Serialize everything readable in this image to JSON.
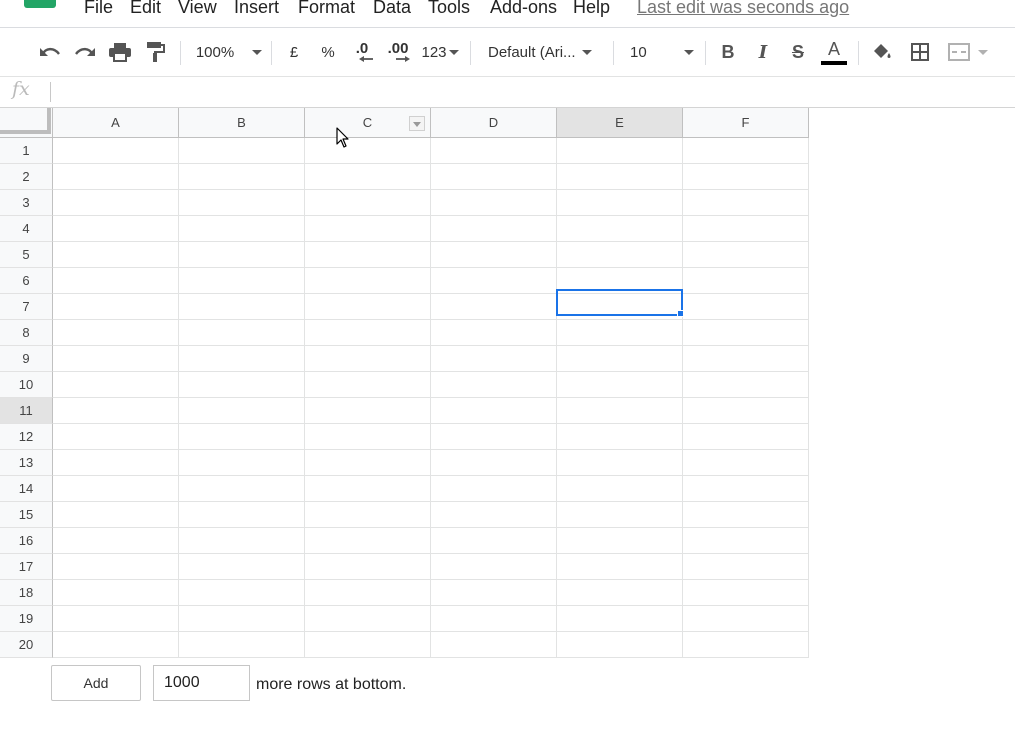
{
  "menu": {
    "items": [
      "File",
      "Edit",
      "View",
      "Insert",
      "Format",
      "Data",
      "Tools",
      "Add-ons",
      "Help"
    ],
    "last_edit": "Last edit was seconds ago"
  },
  "toolbar": {
    "zoom": "100%",
    "currency": "£",
    "percent": "%",
    "decrease_decimal": ".0",
    "increase_decimal": ".00",
    "more_formats": "123",
    "font_family": "Default (Ari...",
    "font_size": "10",
    "bold": "B",
    "italic": "I",
    "strikethrough": "S",
    "text_color_letter": "A",
    "text_color": "#000000",
    "icons": [
      "undo-icon",
      "redo-icon",
      "print-icon",
      "paint-format-icon",
      "fill-color-icon",
      "borders-icon",
      "merge-cells-icon"
    ]
  },
  "formula_bar": {
    "fx_label": "fx",
    "value": ""
  },
  "grid": {
    "columns": [
      "A",
      "B",
      "C",
      "D",
      "E",
      "F"
    ],
    "rows": [
      "1",
      "2",
      "3",
      "4",
      "5",
      "6",
      "7",
      "8",
      "9",
      "10",
      "11",
      "12",
      "13",
      "14",
      "15",
      "16",
      "17",
      "18",
      "19",
      "20"
    ],
    "active_cell": "E11",
    "selection_color": "#1a73e8"
  },
  "footer": {
    "add_label": "Add",
    "rows_value": "1000",
    "rows_suffix": "more rows at bottom."
  }
}
